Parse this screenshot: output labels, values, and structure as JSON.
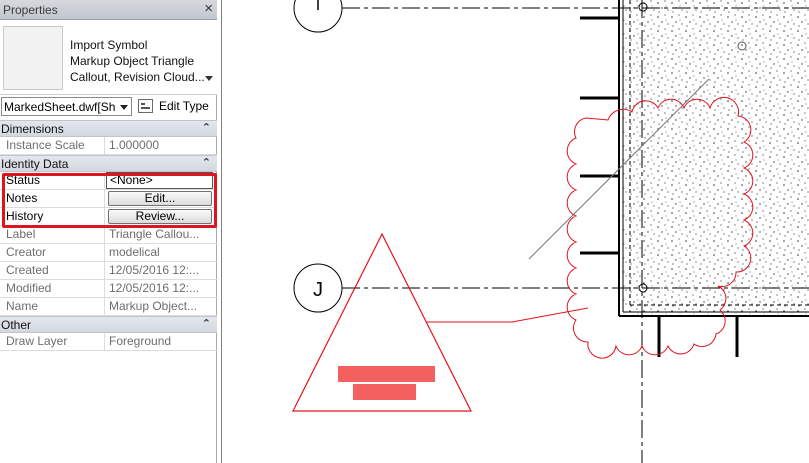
{
  "panel": {
    "title": "Properties",
    "close_glyph": "×"
  },
  "type_selector": {
    "line1": "Import Symbol",
    "line2": "Markup Object Triangle",
    "line3": "Callout, Revision Cloud..."
  },
  "instance_selector": {
    "value": "MarkedSheet.dwf[Sh",
    "edit_type_label": "Edit Type"
  },
  "categories": {
    "dimensions": "Dimensions",
    "identity": "Identity Data",
    "other": "Other",
    "collapse_glyph": "⌃"
  },
  "params": {
    "instance_scale": {
      "label": "Instance Scale",
      "value": "1.000000"
    },
    "status": {
      "label": "Status",
      "value": "<None>"
    },
    "notes": {
      "label": "Notes",
      "button": "Edit..."
    },
    "history": {
      "label": "History",
      "button": "Review..."
    },
    "label": {
      "label": "Label",
      "value": "Triangle Callou..."
    },
    "creator": {
      "label": "Creator",
      "value": "modelical"
    },
    "created": {
      "label": "Created",
      "value": "12/05/2016 12:..."
    },
    "modified": {
      "label": "Modified",
      "value": "12/05/2016 12:..."
    },
    "name": {
      "label": "Name",
      "value": "Markup Object..."
    },
    "draw_layer": {
      "label": "Draw Layer",
      "value": "Foreground"
    }
  },
  "canvas": {
    "grid_j_label": "J",
    "markup_color": "#e0141e",
    "highlight_color": "#e0141e"
  }
}
